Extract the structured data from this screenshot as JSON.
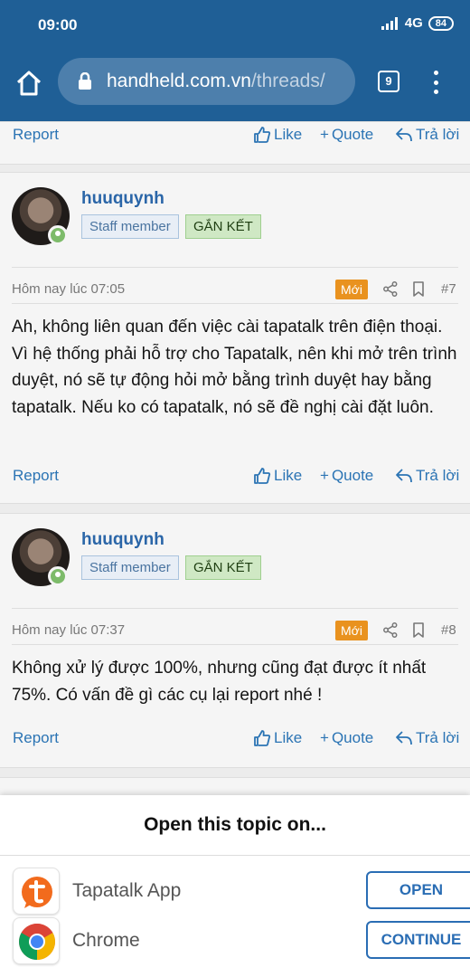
{
  "status_bar": {
    "time": "09:00",
    "network": "4G",
    "battery": "84"
  },
  "browser": {
    "url_host": "handheld.com.vn",
    "url_path": "/threads/",
    "tab_count": "9"
  },
  "actions": {
    "report": "Report",
    "like": "Like",
    "quote": "Quote",
    "reply": "Trả lời"
  },
  "posts": [
    {
      "username": "huuquynh",
      "role_badge": "Staff member",
      "tag_badge": "GẮN KẾT",
      "timestamp": "Hôm nay lúc 07:05",
      "new_badge": "Mới",
      "post_number": "#7",
      "text": "Ah, không liên quan đến việc cài tapatalk trên điện thoại. Vì hệ thống phải hỗ trợ cho Tapatalk, nên khi mở trên trình duyệt, nó sẽ tự động hỏi mở bằng trình duyệt hay bằng tapatalk. Nếu ko có tapatalk, nó sẽ đề nghị cài đặt luôn."
    },
    {
      "username": "huuquynh",
      "role_badge": "Staff member",
      "tag_badge": "GẮN KẾT",
      "timestamp": "Hôm nay lúc 07:37",
      "new_badge": "Mới",
      "post_number": "#8",
      "text": "Không xử lý được 100%, nhưng cũng đạt được ít nhất 75%. Có vấn đề gì các cụ lại report nhé !"
    }
  ],
  "sheet": {
    "title": "Open this topic on...",
    "apps": [
      {
        "name": "Tapatalk App",
        "button": "OPEN",
        "icon": "tapatalk-icon"
      },
      {
        "name": "Chrome",
        "button": "CONTINUE",
        "icon": "chrome-icon"
      }
    ]
  },
  "colors": {
    "toolbar": "#1f5f96",
    "link": "#2b74b4",
    "new_badge": "#e9921f",
    "tag_badge": "#cfe8c4"
  }
}
